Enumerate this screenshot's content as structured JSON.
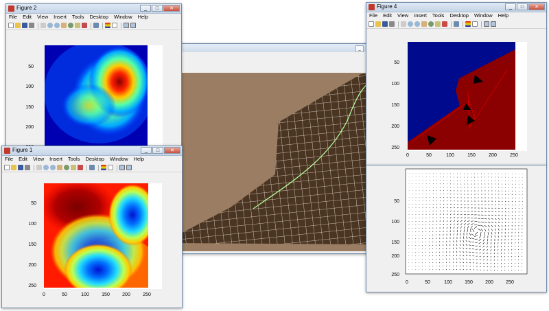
{
  "menu": [
    "File",
    "Edit",
    "View",
    "Insert",
    "Tools",
    "Desktop",
    "Window",
    "Help"
  ],
  "fig2": {
    "title": "Figure 2",
    "yticks": [
      "50",
      "100",
      "150",
      "200",
      "250"
    ]
  },
  "fig1": {
    "title": "Figure 1",
    "yticks": [
      "50",
      "100",
      "150",
      "200",
      "250"
    ],
    "xticks": [
      "0",
      "50",
      "100",
      "150",
      "200",
      "250"
    ]
  },
  "fig4": {
    "title": "Figure 4",
    "yticks": [
      "50",
      "100",
      "150",
      "200",
      "250"
    ],
    "xticks": [
      "0",
      "50",
      "100",
      "150",
      "200",
      "250"
    ]
  },
  "quiver": {
    "yticks": [
      "50",
      "100",
      "150",
      "200",
      "250"
    ],
    "xticks": [
      "0",
      "50",
      "100",
      "150",
      "200",
      "250"
    ]
  },
  "colors": {
    "background_desktop": "#ffffff",
    "terrain": "#9a7d62",
    "grid_region": "#4a3422",
    "grid_line": "#f2e8dc",
    "path_line": "#b8ff9a",
    "blue_region": "#000a8c",
    "red_region": "#8b0000"
  }
}
